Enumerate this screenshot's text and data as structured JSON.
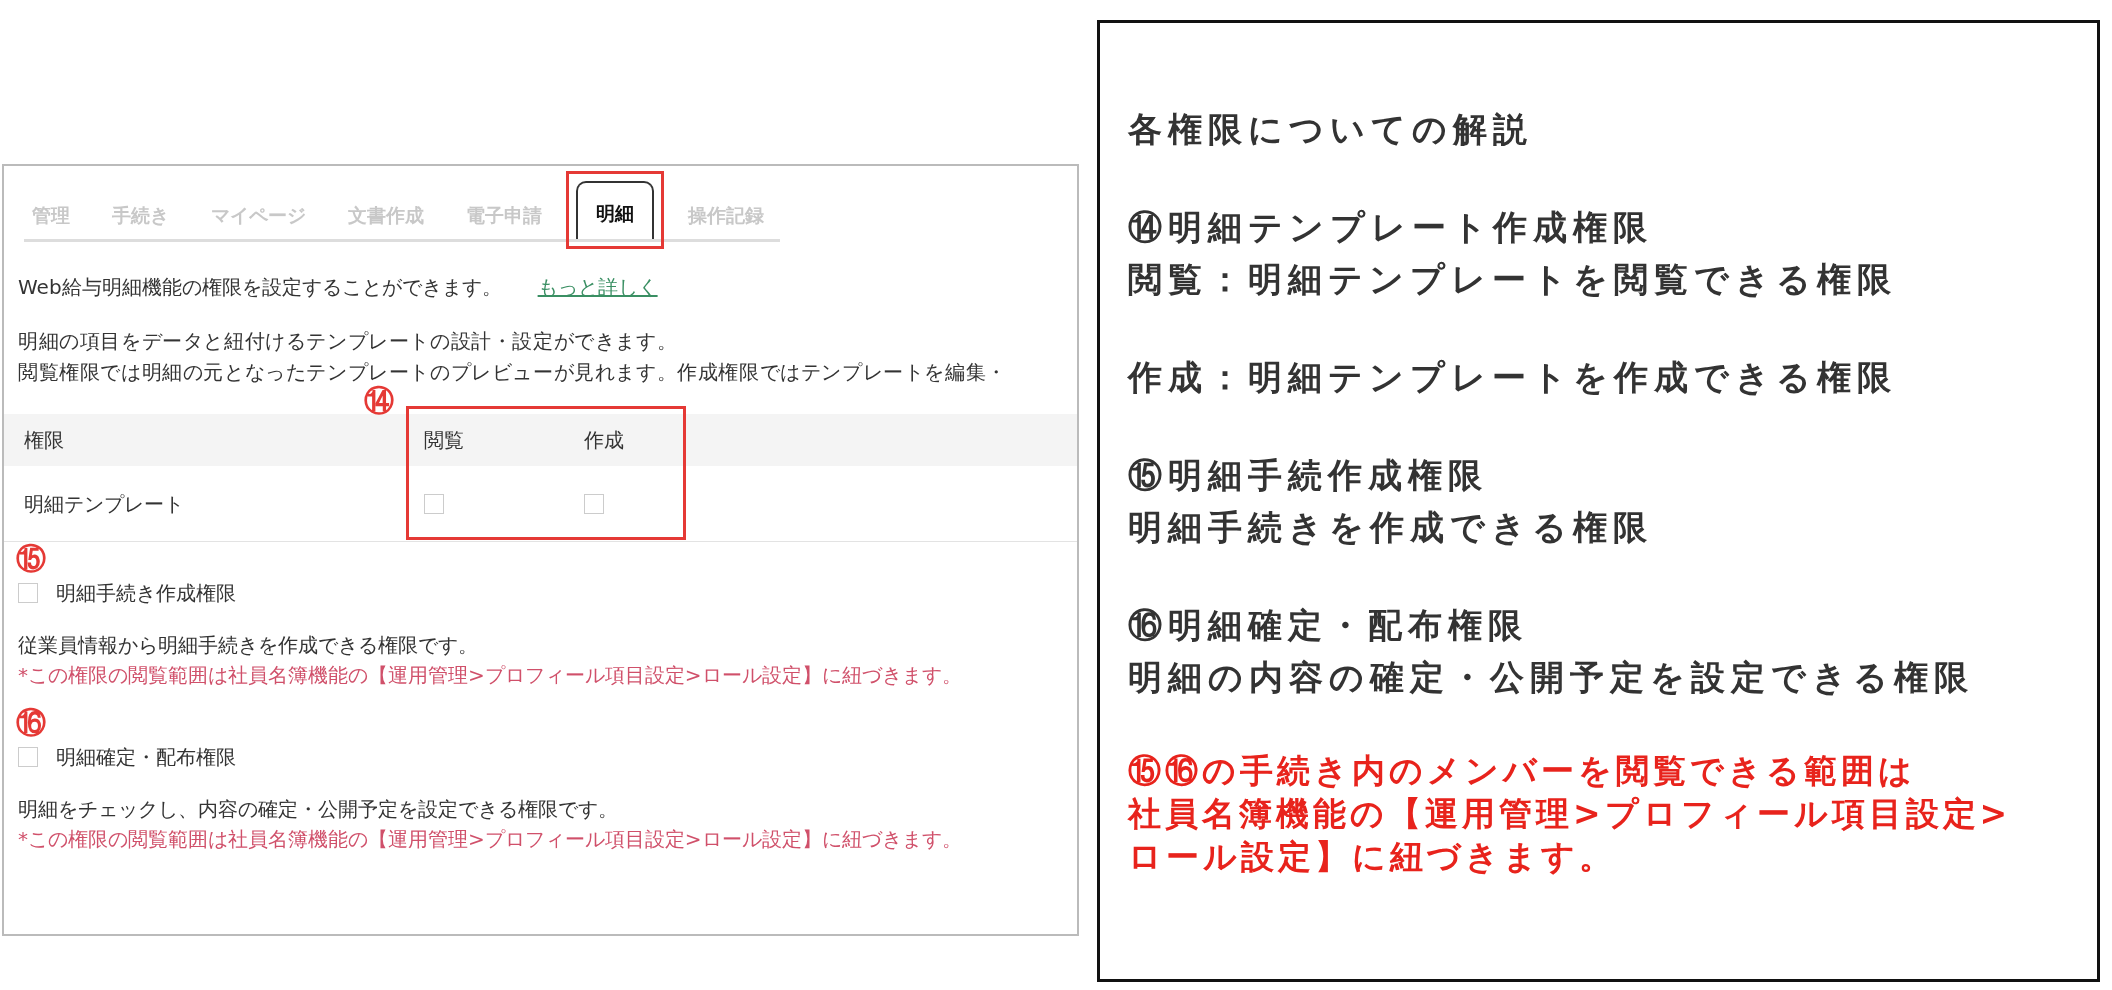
{
  "tabs": [
    {
      "label": "管理",
      "selected": false,
      "highlighted": false
    },
    {
      "label": "手続き",
      "selected": false,
      "highlighted": false
    },
    {
      "label": "マイページ",
      "selected": false,
      "highlighted": false
    },
    {
      "label": "文書作成",
      "selected": false,
      "highlighted": false
    },
    {
      "label": "電子申請",
      "selected": false,
      "highlighted": false
    },
    {
      "label": "明細",
      "selected": true,
      "highlighted": true
    },
    {
      "label": "操作記録",
      "selected": false,
      "highlighted": false
    }
  ],
  "intro": {
    "text": "Web給与明細機能の権限を設定することができます。",
    "link": "もっと詳しく"
  },
  "description": [
    "明細の項目をデータと紐付けるテンプレートの設計・設定ができます。",
    "閲覧権限では明細の元となったテンプレートのプレビューが見れます。作成権限ではテンプレートを編集・"
  ],
  "table": {
    "marker": "⑭",
    "columns": [
      "権限",
      "閲覧",
      "作成"
    ],
    "rows": [
      {
        "label": "明細テンプレート",
        "checks": [
          {
            "checked": false
          },
          {
            "checked": false
          }
        ]
      }
    ]
  },
  "permissions": [
    {
      "marker": "⑮",
      "label": "明細手続き作成権限",
      "checked": false,
      "description": "従業員情報から明細手続きを作成できる権限です。",
      "note": "*この権限の閲覧範囲は社員名簿機能の【運用管理>プロフィール項目設定>ロール設定】に紐づきます。"
    },
    {
      "marker": "⑯",
      "label": "明細確定・配布権限",
      "checked": false,
      "description": "明細をチェックし、内容の確定・公開予定を設定できる権限です。",
      "note": "*この権限の閲覧範囲は社員名簿機能の【運用管理>プロフィール項目設定>ロール設定】に紐づきます。"
    }
  ],
  "explanation": {
    "title": "各権限についての解説",
    "blocks": [
      {
        "lines": [
          "⑭明細テンプレート作成権限",
          "閲覧：明細テンプレートを閲覧できる権限"
        ]
      },
      {
        "lines": [
          "作成：明細テンプレートを作成できる権限"
        ]
      },
      {
        "lines": [
          "⑮明細手続作成権限",
          "明細手続きを作成できる権限"
        ]
      },
      {
        "lines": [
          "⑯明細確定・配布権限",
          "明細の内容の確定・公開予定を設定できる権限"
        ]
      }
    ],
    "note": [
      "⑮⑯の手続き内のメンバーを閲覧できる範囲は",
      "社員名簿機能の【運用管理>プロフィール項目設定>",
      "ロール設定】に紐づきます。"
    ]
  }
}
